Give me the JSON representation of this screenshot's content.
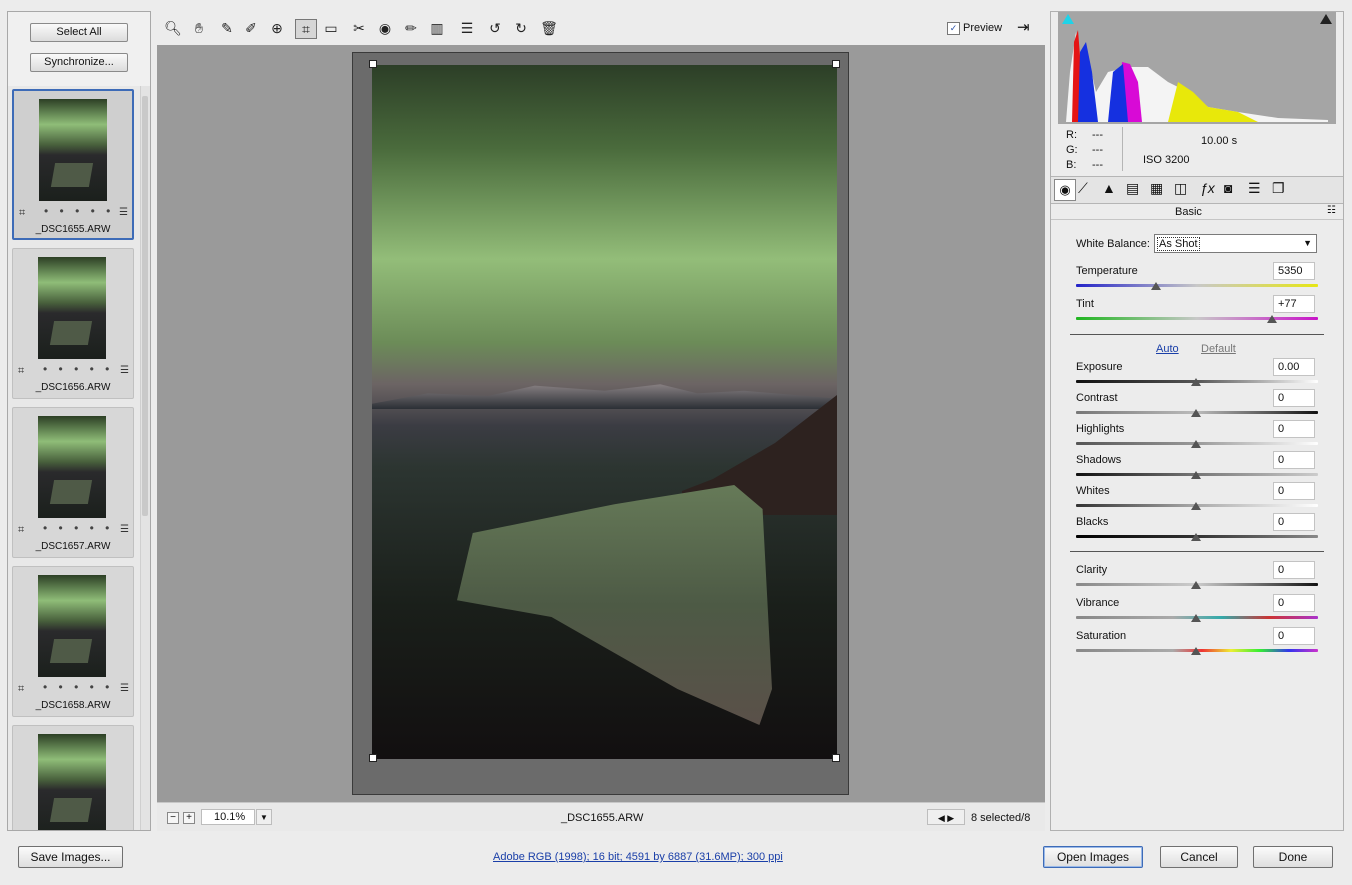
{
  "filmstrip": {
    "select_all": "Select All",
    "synchronize": "Synchronize...",
    "items": [
      {
        "name": "_DSC1655.ARW",
        "dots": "• • • • •"
      },
      {
        "name": "_DSC1656.ARW",
        "dots": "• • • • •"
      },
      {
        "name": "_DSC1657.ARW",
        "dots": "• • • • •"
      },
      {
        "name": "_DSC1658.ARW",
        "dots": "• • • • •"
      },
      {
        "name": "",
        "dots": ""
      }
    ]
  },
  "toolbar": {
    "preview_label": "Preview",
    "preview_checked": true,
    "tools": [
      "zoom-icon",
      "hand-icon",
      "white-balance-icon",
      "color-sampler-icon",
      "targeted-adjustment-icon",
      "crop-icon",
      "straighten-icon",
      "spot-removal-icon",
      "red-eye-icon",
      "adjustment-brush-icon",
      "graduated-filter-icon",
      "preferences-icon",
      "rotate-left-icon",
      "rotate-right-icon",
      "trash-icon"
    ]
  },
  "bottom": {
    "zoom_value": "10.1%",
    "filename": "_DSC1655.ARW",
    "selection": "8 selected/8"
  },
  "histogram": {
    "r_label": "R:",
    "g_label": "G:",
    "b_label": "B:",
    "r_value": "---",
    "g_value": "---",
    "b_value": "---",
    "shutter": "10.00 s",
    "iso": "ISO 3200"
  },
  "panel": {
    "title": "Basic",
    "white_balance_label": "White Balance:",
    "white_balance_value": "As Shot",
    "temperature_label": "Temperature",
    "temperature_value": "5350",
    "temperature_level": 0.34,
    "tint_label": "Tint",
    "tint_value": "+77",
    "tint_level": 0.81,
    "auto": "Auto",
    "default": "Default",
    "exposure_label": "Exposure",
    "exposure_value": "0.00",
    "contrast_label": "Contrast",
    "contrast_value": "0",
    "highlights_label": "Highlights",
    "highlights_value": "0",
    "shadows_label": "Shadows",
    "shadows_value": "0",
    "whites_label": "Whites",
    "whites_value": "0",
    "blacks_label": "Blacks",
    "blacks_value": "0",
    "clarity_label": "Clarity",
    "clarity_value": "0",
    "vibrance_label": "Vibrance",
    "vibrance_value": "0",
    "saturation_label": "Saturation",
    "saturation_value": "0"
  },
  "footer": {
    "save_images": "Save Images...",
    "info_link": "Adobe RGB (1998); 16 bit; 4591 by 6887 (31.6MP); 300 ppi",
    "open_images": "Open Images",
    "cancel": "Cancel",
    "done": "Done"
  },
  "colors": {
    "accent": "#3d6bb7",
    "link": "#1a3fa8"
  }
}
